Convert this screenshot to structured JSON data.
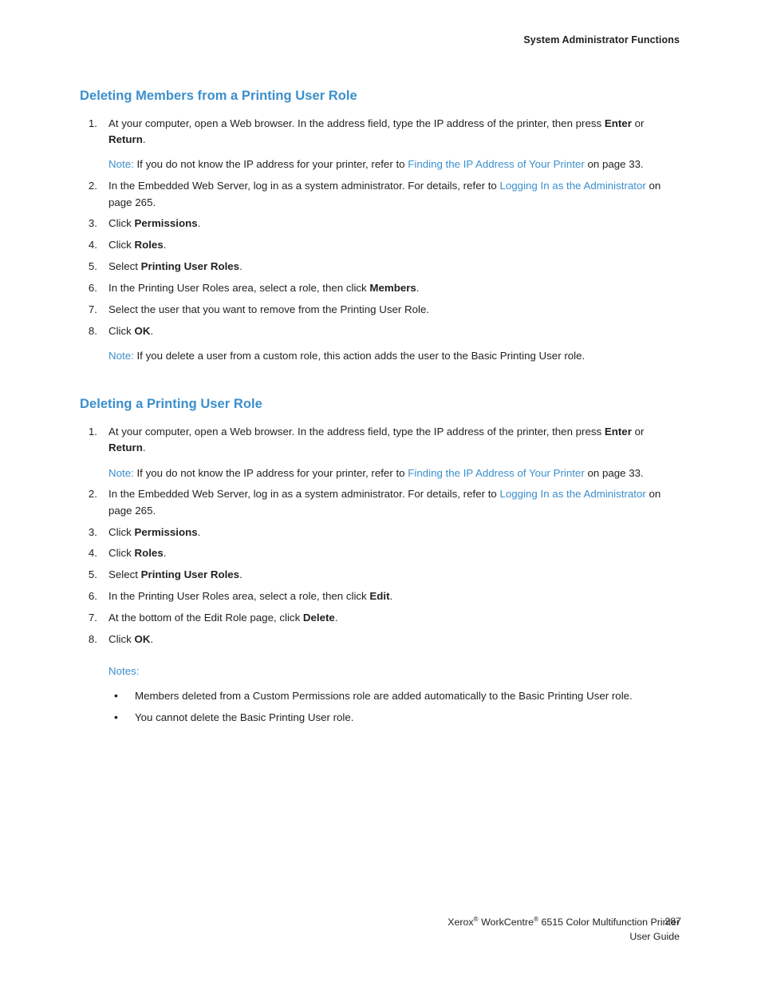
{
  "header": {
    "running_head": "System Administrator Functions"
  },
  "sections": [
    {
      "heading": "Deleting Members from a Printing User Role",
      "steps": [
        {
          "num": "1.",
          "parts": [
            {
              "text": "At your computer, open a Web browser. In the address field, type the IP address of the printer, then press ",
              "style": "normal"
            },
            {
              "text": "Enter",
              "style": "bold"
            },
            {
              "text": " or ",
              "style": "normal"
            },
            {
              "text": "Return",
              "style": "bold"
            },
            {
              "text": ".",
              "style": "normal"
            }
          ],
          "note": {
            "label": "Note:",
            "parts": [
              {
                "text": " If you do not know the IP address for your printer, refer to ",
                "style": "normal"
              },
              {
                "text": "Finding the IP Address of Your Printer",
                "style": "xref"
              },
              {
                "text": " on page 33.",
                "style": "normal"
              }
            ]
          }
        },
        {
          "num": "2.",
          "parts": [
            {
              "text": "In the Embedded Web Server, log in as a system administrator. For details, refer to ",
              "style": "normal"
            },
            {
              "text": "Logging In as the Administrator",
              "style": "xref"
            },
            {
              "text": " on page 265.",
              "style": "normal"
            }
          ]
        },
        {
          "num": "3.",
          "parts": [
            {
              "text": "Click ",
              "style": "normal"
            },
            {
              "text": "Permissions",
              "style": "bold"
            },
            {
              "text": ".",
              "style": "normal"
            }
          ]
        },
        {
          "num": "4.",
          "parts": [
            {
              "text": "Click ",
              "style": "normal"
            },
            {
              "text": "Roles",
              "style": "bold"
            },
            {
              "text": ".",
              "style": "normal"
            }
          ]
        },
        {
          "num": "5.",
          "parts": [
            {
              "text": "Select ",
              "style": "normal"
            },
            {
              "text": "Printing User Roles",
              "style": "bold"
            },
            {
              "text": ".",
              "style": "normal"
            }
          ]
        },
        {
          "num": "6.",
          "parts": [
            {
              "text": "In the Printing User Roles area, select a role, then click ",
              "style": "normal"
            },
            {
              "text": "Members",
              "style": "bold"
            },
            {
              "text": ".",
              "style": "normal"
            }
          ]
        },
        {
          "num": "7.",
          "parts": [
            {
              "text": "Select the user that you want to remove from the Printing User Role.",
              "style": "normal"
            }
          ]
        },
        {
          "num": "8.",
          "parts": [
            {
              "text": "Click ",
              "style": "normal"
            },
            {
              "text": "OK",
              "style": "bold"
            },
            {
              "text": ".",
              "style": "normal"
            }
          ]
        }
      ],
      "trailing_note": {
        "label": "Note:",
        "parts": [
          {
            "text": " If you delete a user from a custom role, this action adds the user to the Basic Printing User role.",
            "style": "normal"
          }
        ]
      }
    },
    {
      "heading": "Deleting a Printing User Role",
      "steps": [
        {
          "num": "1.",
          "parts": [
            {
              "text": "At your computer, open a Web browser. In the address field, type the IP address of the printer, then press ",
              "style": "normal"
            },
            {
              "text": "Enter",
              "style": "bold"
            },
            {
              "text": " or ",
              "style": "normal"
            },
            {
              "text": "Return",
              "style": "bold"
            },
            {
              "text": ".",
              "style": "normal"
            }
          ],
          "note": {
            "label": "Note:",
            "parts": [
              {
                "text": " If you do not know the IP address for your printer, refer to ",
                "style": "normal"
              },
              {
                "text": "Finding the IP Address of Your Printer",
                "style": "xref"
              },
              {
                "text": " on page 33.",
                "style": "normal"
              }
            ]
          }
        },
        {
          "num": "2.",
          "parts": [
            {
              "text": "In the Embedded Web Server, log in as a system administrator. For details, refer to ",
              "style": "normal"
            },
            {
              "text": "Logging In as the Administrator",
              "style": "xref"
            },
            {
              "text": " on page 265.",
              "style": "normal"
            }
          ]
        },
        {
          "num": "3.",
          "parts": [
            {
              "text": "Click ",
              "style": "normal"
            },
            {
              "text": "Permissions",
              "style": "bold"
            },
            {
              "text": ".",
              "style": "normal"
            }
          ]
        },
        {
          "num": "4.",
          "parts": [
            {
              "text": "Click ",
              "style": "normal"
            },
            {
              "text": "Roles",
              "style": "bold"
            },
            {
              "text": ".",
              "style": "normal"
            }
          ]
        },
        {
          "num": "5.",
          "parts": [
            {
              "text": "Select ",
              "style": "normal"
            },
            {
              "text": "Printing User Roles",
              "style": "bold"
            },
            {
              "text": ".",
              "style": "normal"
            }
          ]
        },
        {
          "num": "6.",
          "parts": [
            {
              "text": "In the Printing User Roles area, select a role, then click ",
              "style": "normal"
            },
            {
              "text": "Edit",
              "style": "bold"
            },
            {
              "text": ".",
              "style": "normal"
            }
          ]
        },
        {
          "num": "7.",
          "parts": [
            {
              "text": "At the bottom of the Edit Role page, click ",
              "style": "normal"
            },
            {
              "text": "Delete",
              "style": "bold"
            },
            {
              "text": ".",
              "style": "normal"
            }
          ]
        },
        {
          "num": "8.",
          "parts": [
            {
              "text": "Click ",
              "style": "normal"
            },
            {
              "text": "OK",
              "style": "bold"
            },
            {
              "text": ".",
              "style": "normal"
            }
          ]
        }
      ],
      "notes_block": {
        "label": "Notes:",
        "bullet_char": "•",
        "items": [
          "Members deleted from a Custom Permissions role are added automatically to the Basic Printing User role.",
          "You cannot delete the Basic Printing User role."
        ]
      }
    }
  ],
  "footer": {
    "product_line_1_before_sup1": "Xerox",
    "sup1": "®",
    "product_line_1_mid": " WorkCentre",
    "sup2": "®",
    "product_line_1_after": " 6515 Color Multifunction Printer",
    "product_line_2": "User Guide",
    "page_number": "287"
  },
  "colors": {
    "heading_blue": "#3b8fcd",
    "xref_blue": "#3b8fcd",
    "body_text": "#231f20",
    "page_background": "#ffffff"
  }
}
